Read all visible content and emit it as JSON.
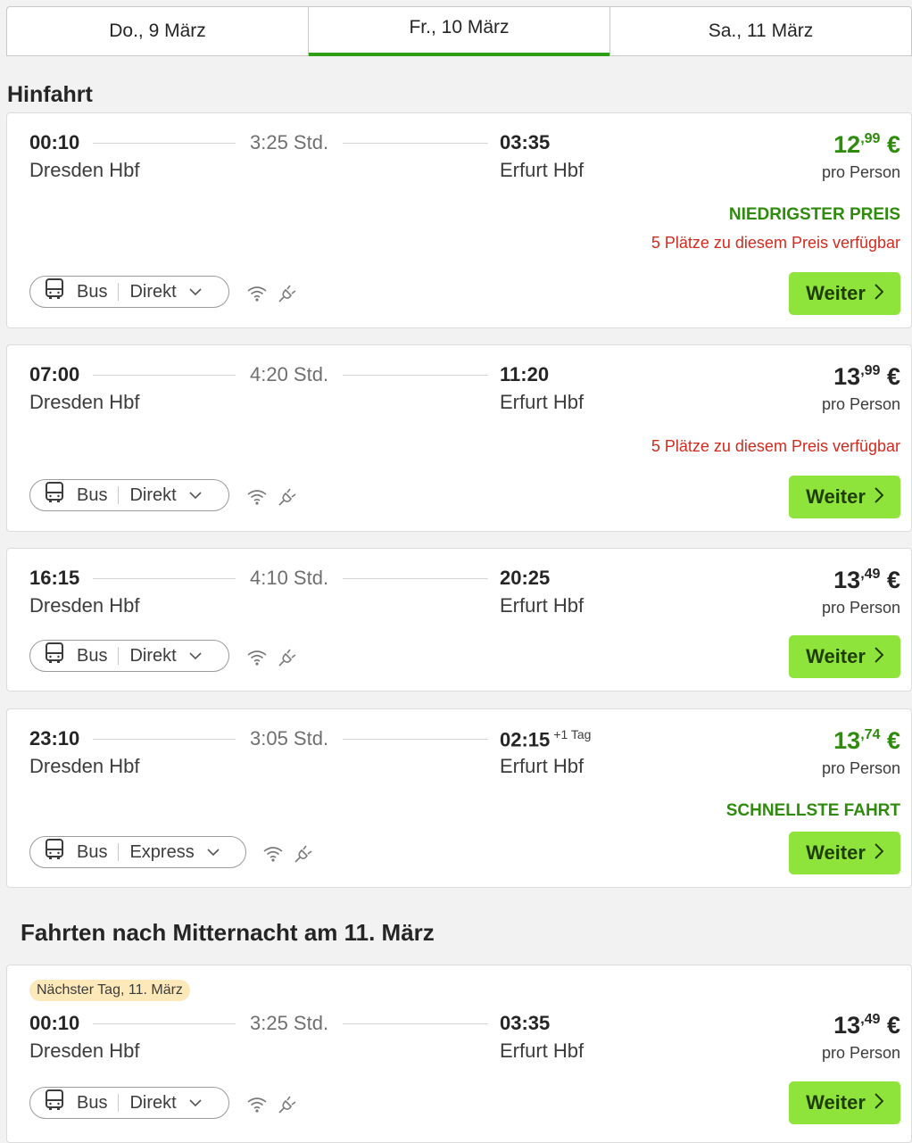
{
  "tabs": [
    {
      "label": "Do., 9 März"
    },
    {
      "label": "Fr., 10 März",
      "active": true
    },
    {
      "label": "Sa., 11 März"
    }
  ],
  "section_title": "Hinfahrt",
  "night_title": "Fahrten nach Mitternacht am 11. März",
  "common": {
    "pro_person": "pro Person",
    "button": "Weiter",
    "mode": "Bus",
    "currency": "€"
  },
  "colors": {
    "accent": "#73d700",
    "green_text": "#2e8b0c",
    "red_text": "#d12b1f",
    "tab_active": "#2e9e14"
  },
  "rides": [
    {
      "dep_time": "00:10",
      "dep_station": "Dresden Hbf",
      "duration": "3:25 Std.",
      "arr_time": "03:35",
      "arr_station": "Erfurt Hbf",
      "price_main": "12",
      "price_cents": ",99",
      "type": "Direkt",
      "tag": "NIEDRIGSTER PREIS",
      "availability": "5 Plätze zu diesem Preis verfügbar"
    },
    {
      "dep_time": "07:00",
      "dep_station": "Dresden Hbf",
      "duration": "4:20 Std.",
      "arr_time": "11:20",
      "arr_station": "Erfurt Hbf",
      "price_main": "13",
      "price_cents": ",99",
      "type": "Direkt",
      "availability": "5 Plätze zu diesem Preis verfügbar"
    },
    {
      "dep_time": "16:15",
      "dep_station": "Dresden Hbf",
      "duration": "4:10 Std.",
      "arr_time": "20:25",
      "arr_station": "Erfurt Hbf",
      "price_main": "13",
      "price_cents": ",49",
      "type": "Direkt"
    },
    {
      "dep_time": "23:10",
      "dep_station": "Dresden Hbf",
      "duration": "3:05 Std.",
      "arr_time": "02:15",
      "arr_plus": "+1 Tag",
      "arr_station": "Erfurt Hbf",
      "price_main": "13",
      "price_cents": ",74",
      "type": "Express",
      "tag": "SCHNELLSTE FAHRT"
    },
    {
      "badge": "Nächster Tag, 11. März",
      "dep_time": "00:10",
      "dep_station": "Dresden Hbf",
      "duration": "3:25 Std.",
      "arr_time": "03:35",
      "arr_station": "Erfurt Hbf",
      "price_main": "13",
      "price_cents": ",49",
      "type": "Direkt"
    }
  ]
}
